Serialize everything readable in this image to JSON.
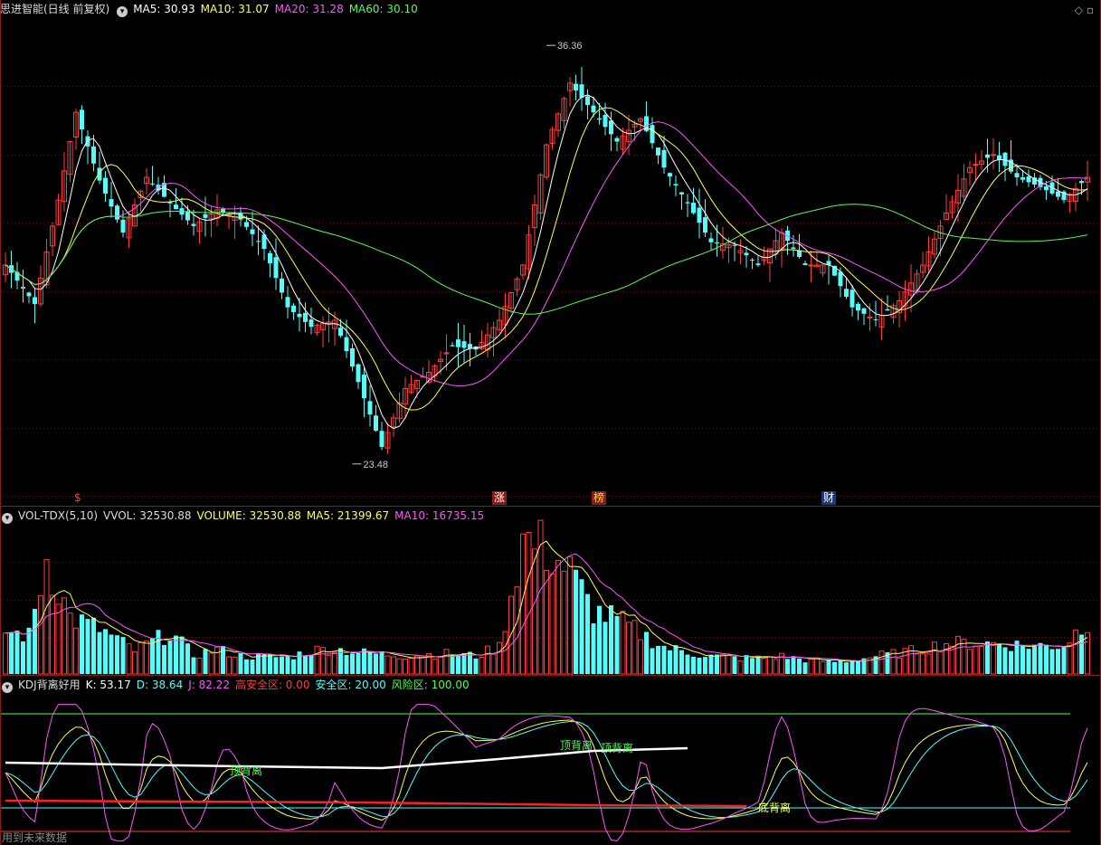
{
  "price_panel": {
    "title": "思进智能(日线 前复权)",
    "ma5": "MA5: 30.93",
    "ma10": "MA10: 31.07",
    "ma20": "MA20: 31.28",
    "ma60": "MA60: 30.10",
    "high_label": "36.36",
    "low_label": "23.48",
    "markers": [
      "$",
      "涨",
      "榜",
      "财"
    ],
    "y_range": [
      22.5,
      37.2
    ],
    "colors": {
      "up": "#ff3c3c",
      "down": "#54fcfc",
      "ma5": "#ffffff",
      "ma10": "#ffff54",
      "ma20": "#ff54ff",
      "ma60": "#54fc54"
    }
  },
  "volume_panel": {
    "title": "VOL-TDX(5,10)",
    "vvol": "VVOL: 32530.88",
    "volume": "VOLUME: 32530.88",
    "ma5": "MA5: 21399.67",
    "ma10": "MA10: 16735.15"
  },
  "kdj_panel": {
    "title": "KDJ背离好用",
    "k": "K: 53.17",
    "d": "D: 38.64",
    "j": "J: 82.22",
    "high_safe": "高安全区: 0.00",
    "safe": "安全区: 20.00",
    "risk": "风险区: 100.00",
    "top_div_1": "顶背离",
    "top_div_2": "顶背离",
    "top_div_3": "顶背离",
    "bottom_div": "底背离"
  },
  "footer": {
    "text": "用到未来数据"
  },
  "corner": {
    "settings": "◇",
    "close": "▫"
  },
  "chart_data": {
    "type": "candlestick",
    "title": "思进智能(日线 前复权)",
    "ylim": [
      22.5,
      37.2
    ],
    "annotations": {
      "high": 36.36,
      "low": 23.48
    },
    "anchors": [
      [
        0,
        29.6
      ],
      [
        5,
        28.4
      ],
      [
        9,
        31.6
      ],
      [
        12,
        34.3
      ],
      [
        16,
        32.2
      ],
      [
        20,
        30.6
      ],
      [
        24,
        32.3
      ],
      [
        28,
        31.5
      ],
      [
        32,
        30.8
      ],
      [
        36,
        31.3
      ],
      [
        40,
        31.0
      ],
      [
        44,
        30.1
      ],
      [
        48,
        28.3
      ],
      [
        52,
        27.7
      ],
      [
        56,
        27.9
      ],
      [
        60,
        26.0
      ],
      [
        64,
        24.0
      ],
      [
        68,
        25.8
      ],
      [
        72,
        26.3
      ],
      [
        76,
        27.1
      ],
      [
        80,
        27.0
      ],
      [
        84,
        27.9
      ],
      [
        88,
        29.6
      ],
      [
        92,
        33.3
      ],
      [
        96,
        35.2
      ],
      [
        100,
        34.3
      ],
      [
        104,
        33.4
      ],
      [
        108,
        34.1
      ],
      [
        112,
        32.6
      ],
      [
        116,
        31.5
      ],
      [
        120,
        30.3
      ],
      [
        124,
        30.2
      ],
      [
        128,
        29.6
      ],
      [
        132,
        30.6
      ],
      [
        136,
        29.6
      ],
      [
        140,
        29.6
      ],
      [
        144,
        28.3
      ],
      [
        148,
        27.9
      ],
      [
        152,
        28.5
      ],
      [
        156,
        29.6
      ],
      [
        160,
        31.2
      ],
      [
        164,
        32.6
      ],
      [
        168,
        33.0
      ],
      [
        172,
        32.3
      ],
      [
        176,
        32.0
      ],
      [
        180,
        31.6
      ],
      [
        184,
        32.3
      ]
    ],
    "volume_anchors": [
      [
        0,
        9500
      ],
      [
        4,
        8500
      ],
      [
        7,
        25500
      ],
      [
        11,
        12500
      ],
      [
        16,
        10000
      ],
      [
        22,
        5200
      ],
      [
        28,
        9200
      ],
      [
        32,
        4200
      ],
      [
        36,
        5500
      ],
      [
        40,
        4000
      ],
      [
        44,
        3900
      ],
      [
        48,
        3700
      ],
      [
        52,
        5200
      ],
      [
        56,
        5600
      ],
      [
        60,
        4800
      ],
      [
        64,
        4400
      ],
      [
        68,
        4100
      ],
      [
        72,
        4300
      ],
      [
        76,
        4500
      ],
      [
        80,
        4000
      ],
      [
        84,
        6000
      ],
      [
        88,
        29800
      ],
      [
        92,
        27500
      ],
      [
        96,
        22500
      ],
      [
        100,
        14000
      ],
      [
        104,
        12000
      ],
      [
        108,
        9000
      ],
      [
        112,
        6000
      ],
      [
        116,
        4800
      ],
      [
        120,
        4000
      ],
      [
        124,
        3600
      ],
      [
        128,
        3500
      ],
      [
        132,
        3900
      ],
      [
        136,
        3200
      ],
      [
        140,
        2700
      ],
      [
        144,
        3000
      ],
      [
        148,
        4000
      ],
      [
        152,
        4600
      ],
      [
        156,
        5500
      ],
      [
        160,
        6800
      ],
      [
        164,
        6800
      ],
      [
        168,
        6800
      ],
      [
        172,
        6500
      ],
      [
        176,
        6300
      ],
      [
        180,
        6400
      ],
      [
        184,
        12000
      ]
    ],
    "volume_max": 33000,
    "kdj_levels": {
      "high_safe": 0,
      "safe": 20,
      "risk": 100
    },
    "kdj_last": {
      "K": 53.17,
      "D": 38.64,
      "J": 82.22
    }
  }
}
